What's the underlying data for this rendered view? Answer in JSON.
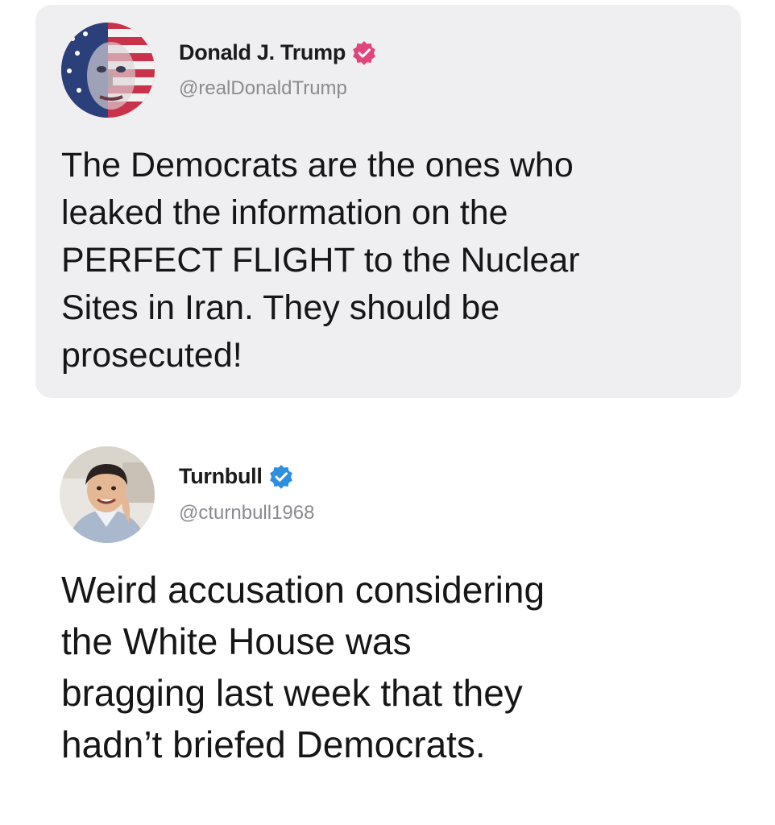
{
  "quoted_post": {
    "display_name": "Donald J. Trump",
    "handle": "@realDonaldTrump",
    "verified_badge": "verified-badge-pink",
    "badge_color": "#e0457b",
    "avatar": "flag-portrait-avatar",
    "text": "The Democrats are the ones who\nleaked the information on the\nPERFECT FLIGHT to the Nuclear\nSites in Iran. They should be\nprosecuted!"
  },
  "reply_post": {
    "display_name": "Turnbull",
    "handle": "@cturnbull1968",
    "verified_badge": "verified-badge-blue",
    "badge_color": "#2d8fe0",
    "avatar": "cartoon-portrait-avatar",
    "text": "Weird accusation considering\nthe White House was\nbragging last week that they\nhadn’t briefed Democrats."
  }
}
